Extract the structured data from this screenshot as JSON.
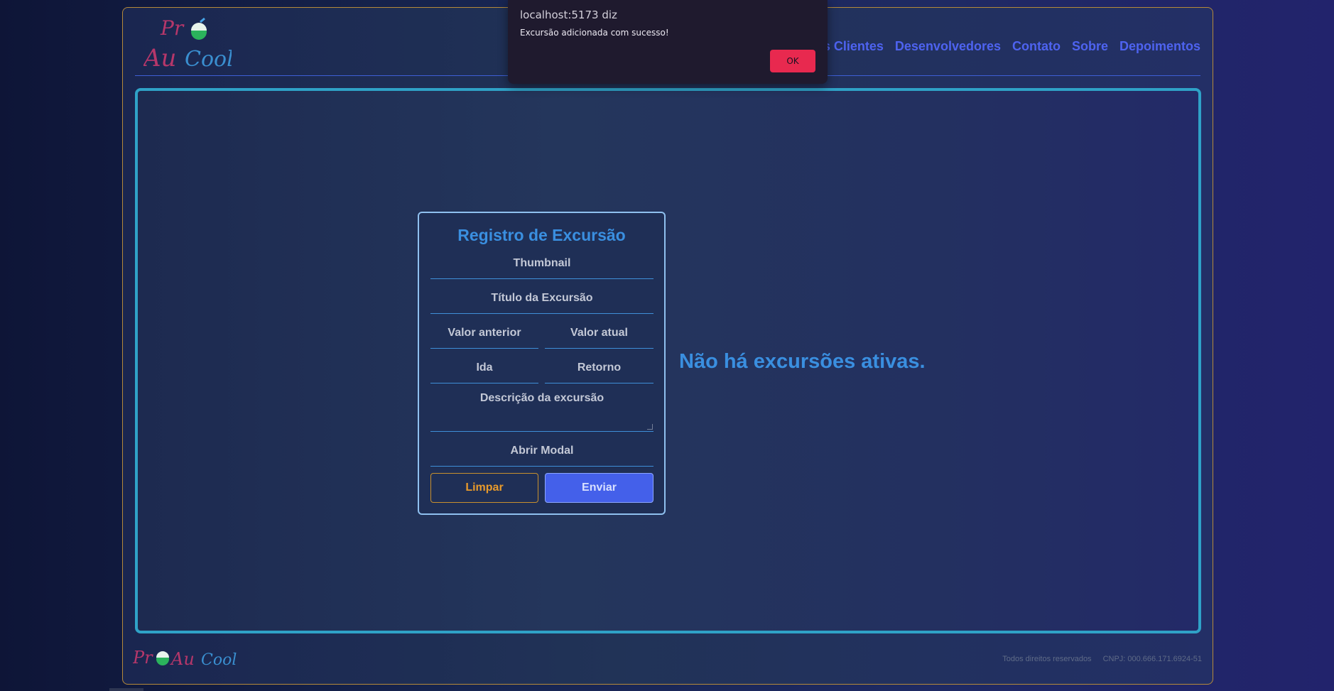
{
  "header": {
    "logo_alt": "ProAuCool",
    "nav": [
      "Possíveis Clientes",
      "Desenvolvedores",
      "Contato",
      "Sobre",
      "Depoimentos"
    ]
  },
  "form": {
    "title": "Registro de Excursão",
    "thumbnail_placeholder": "Thumbnail",
    "title_placeholder": "Título da Excursão",
    "old_price_placeholder": "Valor anterior",
    "current_price_placeholder": "Valor atual",
    "departure_placeholder": "Ida",
    "return_placeholder": "Retorno",
    "description_placeholder": "Descrição da excursão",
    "modal_label": "Abrir Modal",
    "clear_label": "Limpar",
    "submit_label": "Enviar"
  },
  "empty_message": "Não há excursões ativas.",
  "footer": {
    "rights": "Todos direitos reservados",
    "cnpj": "CNPJ: 000.666.171.6924-51"
  },
  "dialog": {
    "origin": "localhost:5173 diz",
    "message": "Excursão adicionada com sucesso!",
    "ok_label": "OK"
  },
  "colors": {
    "accent_blue": "#3a8fe0",
    "nav_blue": "#4e63f0",
    "frame_gold": "#b58a3a",
    "panel_cyan": "#2fa2c7",
    "ok_red": "#e8294f",
    "clear_orange": "#e89a2b",
    "send_blue": "#4460ea"
  }
}
